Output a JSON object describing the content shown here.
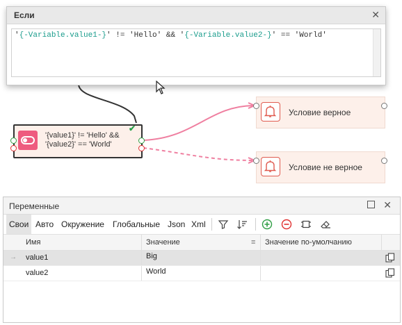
{
  "popup": {
    "title": "Если",
    "expression_parts": [
      "'",
      "{-Variable.value1-}",
      "' != 'Hello' && '",
      "{-Variable.value2-}",
      "' == 'World'"
    ]
  },
  "canvas": {
    "if_node": {
      "line1": "'{value1}' != 'Hello' &&",
      "line2": "'{value2}' == 'World'"
    },
    "true_node": {
      "label": "Условие верное"
    },
    "false_node": {
      "label": "Условие не верное"
    },
    "colors": {
      "accent": "#ee5b7f",
      "true_link": "#ef7fa0",
      "false_link": "#ef7fa0",
      "ok_check": "#27a04a"
    }
  },
  "panel": {
    "title": "Переменные",
    "tabs": [
      "Свои",
      "Авто",
      "Окружение",
      "Глобальные",
      "Json",
      "Xml"
    ],
    "columns": [
      "Имя",
      "Значение",
      "Значение по-умолчанию"
    ],
    "rows": [
      {
        "name": "value1",
        "value": "Big",
        "default": ""
      },
      {
        "name": "value2",
        "value": "World",
        "default": ""
      }
    ],
    "toolbar_icons": [
      "filter-icon",
      "sort-icon",
      "add-icon",
      "remove-icon",
      "frame-icon",
      "eraser-icon"
    ]
  }
}
